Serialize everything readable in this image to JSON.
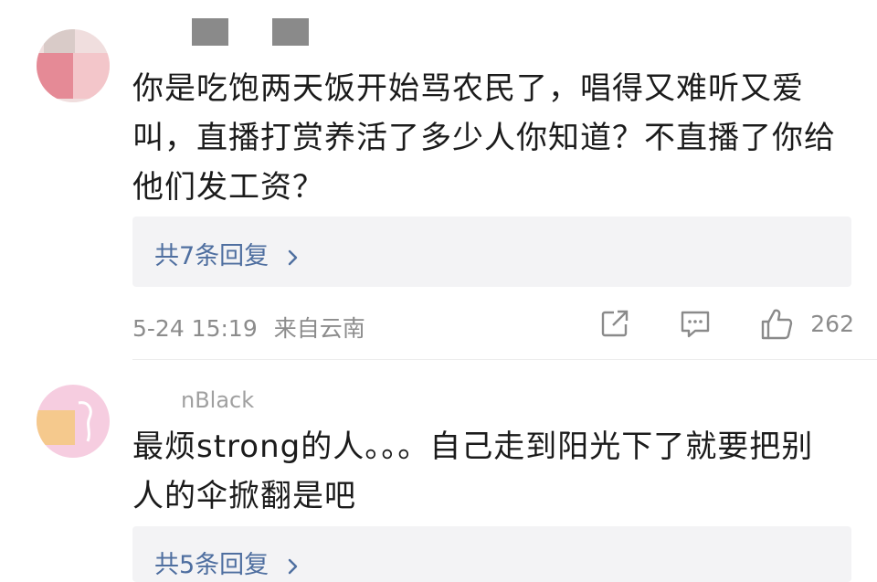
{
  "comments": [
    {
      "username_fragment": "",
      "text_lines": [
        "你是吃饱两天饭开始骂农民了，唱得又难听又爱",
        "叫，直播打赏养活了多少人你知道？不直播了你给",
        "他们发工资？"
      ],
      "replies_label": "共7条回复",
      "time": "5-24 15:19",
      "location": "来自云南",
      "like_count": "262"
    },
    {
      "username_fragment": "nBlack",
      "text_lines": [
        "最烦strong的人。。。自己走到阳光下了就要把别",
        "人的伞掀翻是吧"
      ],
      "replies_label": "共5条回复"
    }
  ],
  "icons": {
    "share": "share-icon",
    "comment": "comment-icon",
    "like": "thumbs-up-icon",
    "reply_arrow": "chevron-right-icon"
  },
  "colors": {
    "link": "#4f6fa0",
    "meta": "#8c8c8c",
    "reply_bg": "#f3f3f5"
  }
}
